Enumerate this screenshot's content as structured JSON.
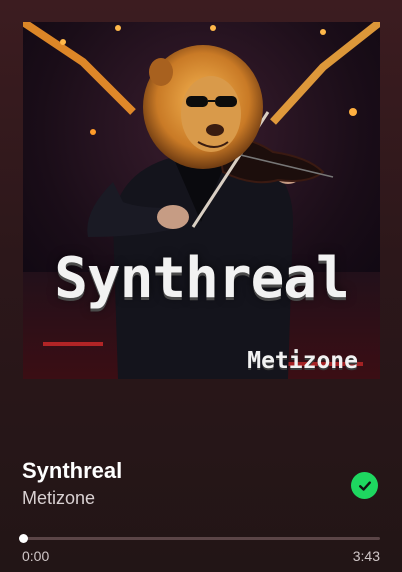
{
  "album_art": {
    "title_text": "Synthreal",
    "artist_text": "Metizone"
  },
  "track": {
    "title": "Synthreal",
    "artist": "Metizone",
    "saved": true
  },
  "playback": {
    "elapsed": "0:00",
    "duration": "3:43",
    "progress_fraction": 0.0
  },
  "icons": {
    "saved": "check-circle-icon"
  },
  "colors": {
    "accent_green": "#1ed760"
  }
}
